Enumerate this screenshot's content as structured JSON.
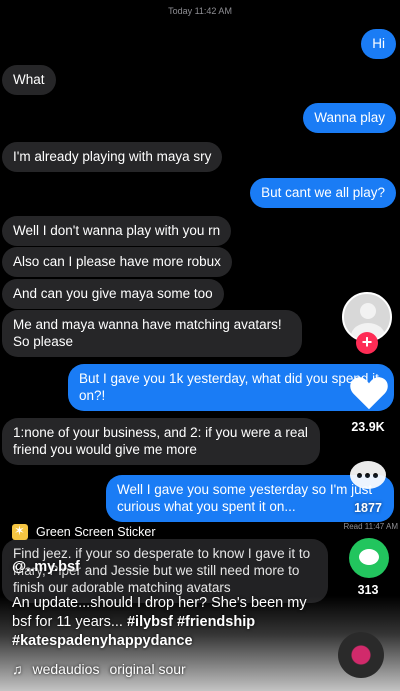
{
  "timestamp": "Today 11:42 AM",
  "messages": [
    {
      "side": "sent",
      "text": "Hi"
    },
    {
      "side": "recv",
      "text": "What"
    },
    {
      "side": "sent",
      "text": "Wanna play"
    },
    {
      "side": "recv",
      "text": "I'm already playing with maya sry"
    },
    {
      "side": "sent",
      "text": "But cant we all play?"
    },
    {
      "side": "recv",
      "text": "Well I don't wanna play with you rn"
    },
    {
      "side": "recv",
      "text": "Also can I please have more robux"
    },
    {
      "side": "recv",
      "text": "And can you give maya some too"
    },
    {
      "side": "recv",
      "text": "Me and maya wanna have matching avatars! So please"
    },
    {
      "side": "sent",
      "text": "But I gave you 1k yesterday, what did you spend it on?!"
    },
    {
      "side": "recv",
      "text": "1:none of your business, and 2: if you were a real friend you would give me more"
    },
    {
      "side": "sent",
      "text": "Well I gave you some yesterday so I'm just curious what you spent it on..."
    },
    {
      "side": "recv",
      "text": "Find jeez. if your so desperate to know I gave it to Mary, Piper and Jessie but we still need more to finish our adorable matching avatars"
    }
  ],
  "read_receipt": "Read 11:47 AM",
  "rail": {
    "likes": "23.9K",
    "comments": "1877",
    "shares": "313"
  },
  "sticker_label": "Green Screen Sticker",
  "username": "@..my.bsf",
  "caption_text": "An update...should I drop her? She's been my bsf for 11 years...",
  "hashtags": "#ilybsf #friendship #katespadenyhappydance",
  "sound": {
    "user": "wedaudios",
    "name": "original sour"
  },
  "colors": {
    "sent": "#1a7cf5",
    "recv": "#262628",
    "follow": "#fe2c55",
    "green": "#22c55e"
  }
}
